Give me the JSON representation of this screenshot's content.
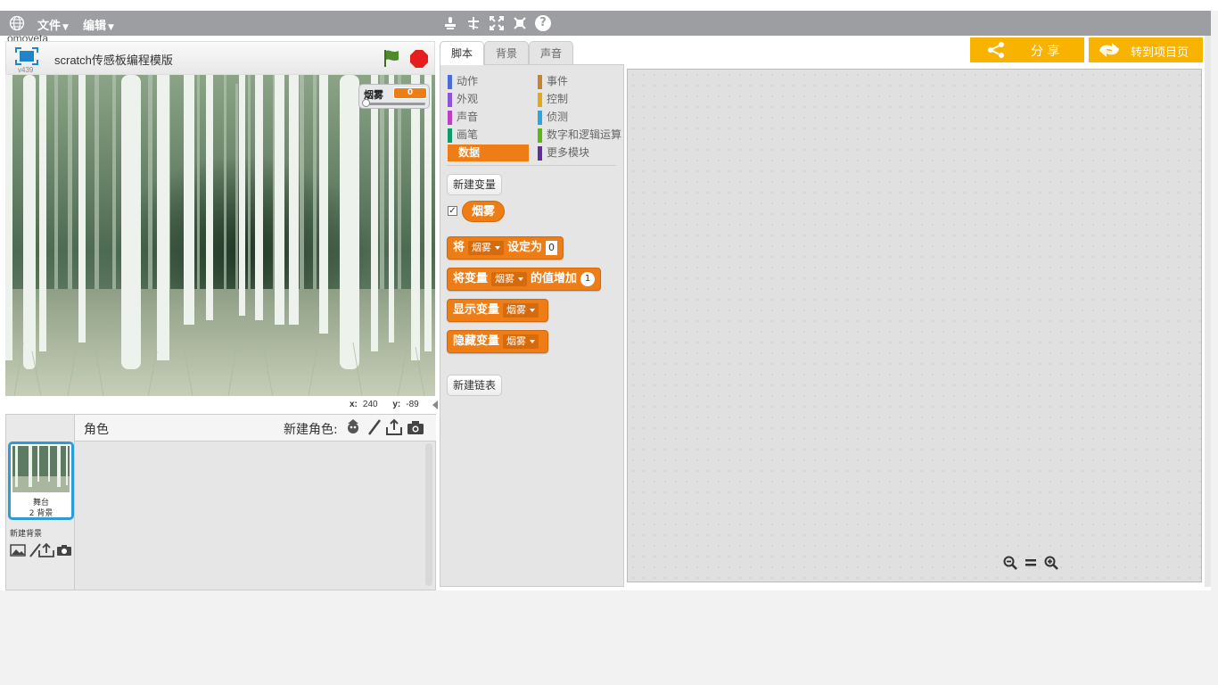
{
  "menu": {
    "file": "文件",
    "edit": "编辑"
  },
  "under_text": "omoyeta",
  "stage": {
    "version": "v439",
    "title": "scratch传感板编程模版",
    "monitor": {
      "name": "烟雾",
      "value": "0"
    },
    "coords": {
      "x_label": "x:",
      "x": "240",
      "y_label": "y:",
      "y": "-89"
    }
  },
  "sprites": {
    "label": "角色",
    "new_sprite": "新建角色:",
    "stage_thumb": {
      "title": "舞台",
      "subtitle": "2 背景"
    },
    "new_backdrop": "新建背景"
  },
  "tabs": [
    "脚本",
    "背景",
    "声音"
  ],
  "categories": {
    "left": [
      {
        "label": "动作",
        "color": "#4a6cd4"
      },
      {
        "label": "外观",
        "color": "#8a55d7"
      },
      {
        "label": "声音",
        "color": "#bb42c3"
      },
      {
        "label": "画笔",
        "color": "#0e9a6c"
      },
      {
        "label": "数据",
        "color": "#ee7d16"
      }
    ],
    "right": [
      {
        "label": "事件",
        "color": "#c88330"
      },
      {
        "label": "控制",
        "color": "#e1a91a"
      },
      {
        "label": "侦测",
        "color": "#2ca5e2"
      },
      {
        "label": "数字和逻辑运算",
        "color": "#5cb712"
      },
      {
        "label": "更多模块",
        "color": "#632d99"
      }
    ],
    "selected": "数据"
  },
  "palette": {
    "new_variable": "新建变量",
    "variable": "烟雾",
    "variable_checked": true,
    "blocks": {
      "set": {
        "pre": "将",
        "var": "烟雾",
        "mid": "设定为",
        "val": "0"
      },
      "change": {
        "pre": "将变量",
        "var": "烟雾",
        "mid": "的值增加",
        "val": "1"
      },
      "show": {
        "pre": "显示变量",
        "var": "烟雾"
      },
      "hide": {
        "pre": "隐藏变量",
        "var": "烟雾"
      }
    },
    "new_list": "新建链表"
  },
  "buttons": {
    "share": "分 享",
    "goto_project": "转到项目页"
  },
  "colors": {
    "menubar": "#9c9ea2",
    "data_orange": "#ee7d16",
    "share_yellow": "#f8b300",
    "selected_blue": "#2d9bd6"
  },
  "icons": [
    "globe-icon",
    "stamp-icon",
    "cut-icon",
    "grow-icon",
    "shrink-icon",
    "help-icon",
    "green-flag-icon",
    "stop-icon",
    "fullscreen-icon",
    "sprite-library-icon",
    "paint-icon",
    "upload-icon",
    "camera-icon",
    "backdrop-library-icon",
    "zoom-out-icon",
    "zoom-reset-icon",
    "zoom-in-icon",
    "share-icon",
    "goto-icon"
  ]
}
